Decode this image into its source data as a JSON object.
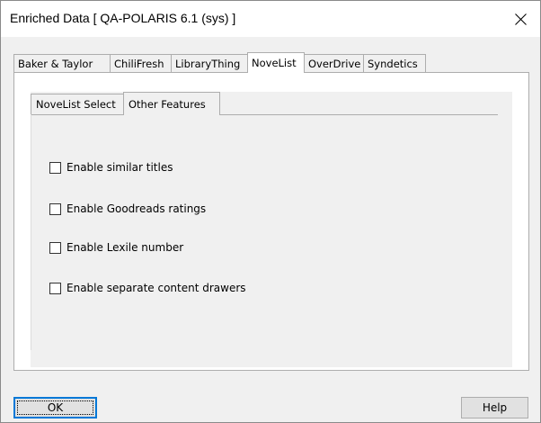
{
  "window": {
    "title": "Enriched Data [ QA-POLARIS 6.1 (sys) ]",
    "close_icon": "close-icon"
  },
  "outer_tabs": [
    {
      "label": "Baker & Taylor",
      "selected": false
    },
    {
      "label": "ChiliFresh",
      "selected": false
    },
    {
      "label": "LibraryThing",
      "selected": false
    },
    {
      "label": "NoveList",
      "selected": true
    },
    {
      "label": "OverDrive",
      "selected": false
    },
    {
      "label": "Syndetics",
      "selected": false
    }
  ],
  "inner_tabs": [
    {
      "label": "NoveList Select",
      "selected": false
    },
    {
      "label": "Other Features",
      "selected": true
    }
  ],
  "options": [
    {
      "label": "Enable similar titles",
      "checked": false
    },
    {
      "label": "Enable Goodreads ratings",
      "checked": false
    },
    {
      "label": "Enable Lexile number",
      "checked": false
    },
    {
      "label": "Enable separate content drawers",
      "checked": false
    }
  ],
  "buttons": {
    "ok_label": "OK",
    "help_label": "Help"
  },
  "colors": {
    "focus_border": "#0078d7",
    "panel_bg": "#f0f0f0"
  }
}
